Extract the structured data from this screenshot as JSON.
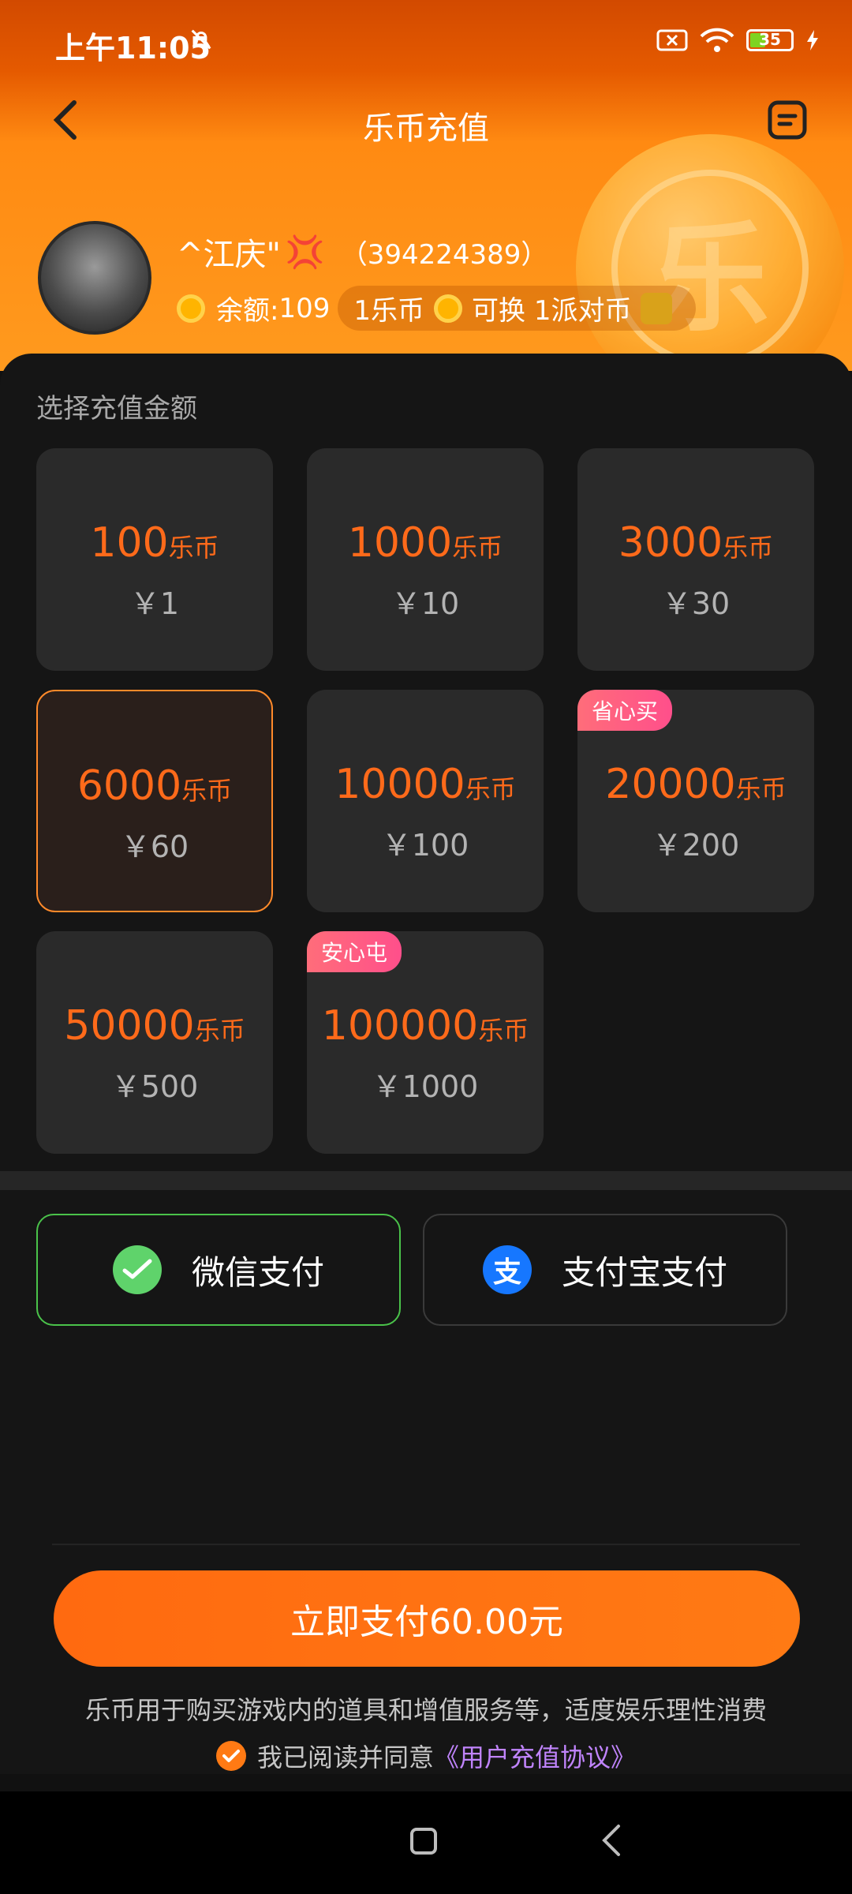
{
  "status": {
    "time": "上午11:05",
    "battery": "35"
  },
  "topbar": {
    "title": "乐币充值"
  },
  "user": {
    "name": "^江庆\"",
    "id": "（394224389）",
    "balance_label": "余额:",
    "balance": "109",
    "rate_coin": "1乐币",
    "rate_text": "可换 1派对币"
  },
  "section_label": "选择充值金额",
  "packages": [
    {
      "amount": "100",
      "unit": "乐币",
      "price": "￥1",
      "badge": "",
      "selected": false
    },
    {
      "amount": "1000",
      "unit": "乐币",
      "price": "￥10",
      "badge": "",
      "selected": false
    },
    {
      "amount": "3000",
      "unit": "乐币",
      "price": "￥30",
      "badge": "",
      "selected": false
    },
    {
      "amount": "6000",
      "unit": "乐币",
      "price": "￥60",
      "badge": "",
      "selected": true
    },
    {
      "amount": "10000",
      "unit": "乐币",
      "price": "￥100",
      "badge": "",
      "selected": false
    },
    {
      "amount": "20000",
      "unit": "乐币",
      "price": "￥200",
      "badge": "省心买",
      "selected": false
    },
    {
      "amount": "50000",
      "unit": "乐币",
      "price": "￥500",
      "badge": "",
      "selected": false
    },
    {
      "amount": "100000",
      "unit": "乐币",
      "price": "￥1000",
      "badge": "安心屯",
      "selected": false
    }
  ],
  "payment": {
    "wechat": "微信支付",
    "alipay": "支付宝支付"
  },
  "cta": "立即支付60.00元",
  "note": "乐币用于购买游戏内的道具和增值服务等，适度娱乐理性消费",
  "agree": {
    "text": "我已阅读并同意",
    "link": "《用户充值协议》"
  },
  "colors": {
    "accent": "#ff7a14",
    "price_orange": "#ff6a1a",
    "wechat_green": "#4ac24a",
    "alipay_blue": "#1677ff",
    "link_purple": "#c084fc"
  },
  "icons": {
    "back": "chevron-left-icon",
    "menu": "document-icon",
    "coin": "coin-icon",
    "wechat": "wechat-icon",
    "alipay": "alipay-icon",
    "check": "check-icon"
  }
}
